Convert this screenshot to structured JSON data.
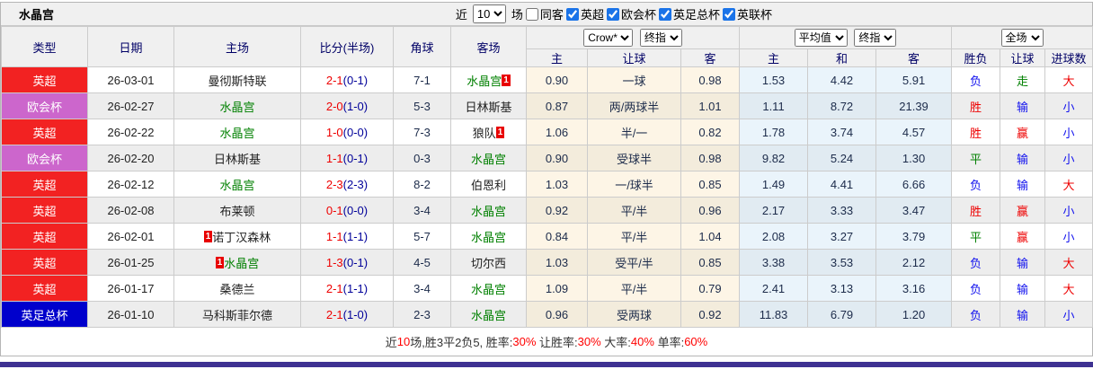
{
  "header": {
    "team": "水晶宫",
    "near_label": "近",
    "count_value": "10",
    "matches_label": "场",
    "same_venue": {
      "label": "同客",
      "checked": false
    },
    "leagues": [
      {
        "label": "英超",
        "checked": true
      },
      {
        "label": "欧会杯",
        "checked": true
      },
      {
        "label": "英足总杯",
        "checked": true
      },
      {
        "label": "英联杯",
        "checked": true
      }
    ]
  },
  "controls": {
    "crown_company": "Crow*",
    "crown_index": "终指",
    "euro_company": "平均值",
    "euro_index": "终指",
    "scope": "全场"
  },
  "columns": {
    "main": [
      "类型",
      "日期",
      "主场",
      "比分(半场)",
      "角球",
      "客场"
    ],
    "sub": [
      "主",
      "让球",
      "客",
      "主",
      "和",
      "客",
      "胜负",
      "让球",
      "进球数"
    ]
  },
  "league_colors": {
    "英超": "#f22222",
    "欧会杯": "#cc66cc",
    "英足总杯": "#0000cc"
  },
  "rows": [
    {
      "league": "英超",
      "date": "26-03-01",
      "home": "曼彻斯特联",
      "home_team_color": "black",
      "home_card": "",
      "home_card_pos": "",
      "score": "2-1",
      "half": "(0-1)",
      "corners": "7-1",
      "away": "水晶宫",
      "away_team_color": "green",
      "away_card": "1",
      "away_card_pos": "after",
      "ah_home": "0.90",
      "ah_line": "一球",
      "ah_away": "0.98",
      "eu_home": "1.53",
      "eu_draw": "4.42",
      "eu_away": "5.91",
      "result": "负",
      "result_color": "blue",
      "handicap_result": "走",
      "handicap_color": "green",
      "goals": "大",
      "goals_color": "red"
    },
    {
      "league": "欧会杯",
      "date": "26-02-27",
      "home": "水晶宫",
      "home_team_color": "green",
      "home_card": "",
      "home_card_pos": "",
      "score": "2-0",
      "half": "(1-0)",
      "corners": "5-3",
      "away": "日林斯基",
      "away_team_color": "black",
      "away_card": "",
      "away_card_pos": "",
      "ah_home": "0.87",
      "ah_line": "两/两球半",
      "ah_away": "1.01",
      "eu_home": "1.11",
      "eu_draw": "8.72",
      "eu_away": "21.39",
      "result": "胜",
      "result_color": "red",
      "handicap_result": "输",
      "handicap_color": "blue",
      "goals": "小",
      "goals_color": "blue"
    },
    {
      "league": "英超",
      "date": "26-02-22",
      "home": "水晶宫",
      "home_team_color": "green",
      "home_card": "",
      "home_card_pos": "",
      "score": "1-0",
      "half": "(0-0)",
      "corners": "7-3",
      "away": "狼队",
      "away_team_color": "black",
      "away_card": "1",
      "away_card_pos": "after",
      "ah_home": "1.06",
      "ah_line": "半/一",
      "ah_away": "0.82",
      "eu_home": "1.78",
      "eu_draw": "3.74",
      "eu_away": "4.57",
      "result": "胜",
      "result_color": "red",
      "handicap_result": "赢",
      "handicap_color": "red",
      "goals": "小",
      "goals_color": "blue"
    },
    {
      "league": "欧会杯",
      "date": "26-02-20",
      "home": "日林斯基",
      "home_team_color": "black",
      "home_card": "",
      "home_card_pos": "",
      "score": "1-1",
      "half": "(0-1)",
      "corners": "0-3",
      "away": "水晶宫",
      "away_team_color": "green",
      "away_card": "",
      "away_card_pos": "",
      "ah_home": "0.90",
      "ah_line": "受球半",
      "ah_away": "0.98",
      "eu_home": "9.82",
      "eu_draw": "5.24",
      "eu_away": "1.30",
      "result": "平",
      "result_color": "green",
      "handicap_result": "输",
      "handicap_color": "blue",
      "goals": "小",
      "goals_color": "blue"
    },
    {
      "league": "英超",
      "date": "26-02-12",
      "home": "水晶宫",
      "home_team_color": "green",
      "home_card": "",
      "home_card_pos": "",
      "score": "2-3",
      "half": "(2-3)",
      "corners": "8-2",
      "away": "伯恩利",
      "away_team_color": "black",
      "away_card": "",
      "away_card_pos": "",
      "ah_home": "1.03",
      "ah_line": "一/球半",
      "ah_away": "0.85",
      "eu_home": "1.49",
      "eu_draw": "4.41",
      "eu_away": "6.66",
      "result": "负",
      "result_color": "blue",
      "handicap_result": "输",
      "handicap_color": "blue",
      "goals": "大",
      "goals_color": "red"
    },
    {
      "league": "英超",
      "date": "26-02-08",
      "home": "布莱顿",
      "home_team_color": "black",
      "home_card": "",
      "home_card_pos": "",
      "score": "0-1",
      "half": "(0-0)",
      "corners": "3-4",
      "away": "水晶宫",
      "away_team_color": "green",
      "away_card": "",
      "away_card_pos": "",
      "ah_home": "0.92",
      "ah_line": "平/半",
      "ah_away": "0.96",
      "eu_home": "2.17",
      "eu_draw": "3.33",
      "eu_away": "3.47",
      "result": "胜",
      "result_color": "red",
      "handicap_result": "赢",
      "handicap_color": "red",
      "goals": "小",
      "goals_color": "blue"
    },
    {
      "league": "英超",
      "date": "26-02-01",
      "home": "诺丁汉森林",
      "home_team_color": "black",
      "home_card": "1",
      "home_card_pos": "before",
      "score": "1-1",
      "half": "(1-1)",
      "corners": "5-7",
      "away": "水晶宫",
      "away_team_color": "green",
      "away_card": "",
      "away_card_pos": "",
      "ah_home": "0.84",
      "ah_line": "平/半",
      "ah_away": "1.04",
      "eu_home": "2.08",
      "eu_draw": "3.27",
      "eu_away": "3.79",
      "result": "平",
      "result_color": "green",
      "handicap_result": "赢",
      "handicap_color": "red",
      "goals": "小",
      "goals_color": "blue"
    },
    {
      "league": "英超",
      "date": "26-01-25",
      "home": "水晶宫",
      "home_team_color": "green",
      "home_card": "1",
      "home_card_pos": "before",
      "score": "1-3",
      "half": "(0-1)",
      "corners": "4-5",
      "away": "切尔西",
      "away_team_color": "black",
      "away_card": "",
      "away_card_pos": "",
      "ah_home": "1.03",
      "ah_line": "受平/半",
      "ah_away": "0.85",
      "eu_home": "3.38",
      "eu_draw": "3.53",
      "eu_away": "2.12",
      "result": "负",
      "result_color": "blue",
      "handicap_result": "输",
      "handicap_color": "blue",
      "goals": "大",
      "goals_color": "red"
    },
    {
      "league": "英超",
      "date": "26-01-17",
      "home": "桑德兰",
      "home_team_color": "black",
      "home_card": "",
      "home_card_pos": "",
      "score": "2-1",
      "half": "(1-1)",
      "corners": "3-4",
      "away": "水晶宫",
      "away_team_color": "green",
      "away_card": "",
      "away_card_pos": "",
      "ah_home": "1.09",
      "ah_line": "平/半",
      "ah_away": "0.79",
      "eu_home": "2.41",
      "eu_draw": "3.13",
      "eu_away": "3.16",
      "result": "负",
      "result_color": "blue",
      "handicap_result": "输",
      "handicap_color": "blue",
      "goals": "大",
      "goals_color": "red"
    },
    {
      "league": "英足总杯",
      "date": "26-01-10",
      "home": "马科斯菲尔德",
      "home_team_color": "black",
      "home_card": "",
      "home_card_pos": "",
      "score": "2-1",
      "half": "(1-0)",
      "corners": "2-3",
      "away": "水晶宫",
      "away_team_color": "green",
      "away_card": "",
      "away_card_pos": "",
      "ah_home": "0.96",
      "ah_line": "受两球",
      "ah_away": "0.92",
      "eu_home": "11.83",
      "eu_draw": "6.79",
      "eu_away": "1.20",
      "result": "负",
      "result_color": "blue",
      "handicap_result": "输",
      "handicap_color": "blue",
      "goals": "小",
      "goals_color": "blue"
    }
  ],
  "footer": {
    "segments": [
      {
        "text": "近",
        "color": "black"
      },
      {
        "text": "10",
        "color": "red"
      },
      {
        "text": "场,胜3平2负5, 胜率:",
        "color": "black"
      },
      {
        "text": "30%",
        "color": "red"
      },
      {
        "text": " 让胜率:",
        "color": "black"
      },
      {
        "text": "30%",
        "color": "red"
      },
      {
        "text": " 大率:",
        "color": "black"
      },
      {
        "text": "40%",
        "color": "red"
      },
      {
        "text": " 单率:",
        "color": "black"
      },
      {
        "text": "60%",
        "color": "red"
      }
    ]
  },
  "colors": {
    "accent_checkbox": "#1a73e8",
    "league_red": "#f22222",
    "league_purple": "#cc66cc",
    "league_blue": "#0000cc",
    "team_highlight_green": "#008000",
    "score_fulltime_red": "#ee0000",
    "score_halftime_navy": "#000099",
    "result_red": "#ee0000",
    "result_green": "#008000",
    "result_blue": "#1111ee",
    "bottom_bar_purple": "#3e3192"
  }
}
